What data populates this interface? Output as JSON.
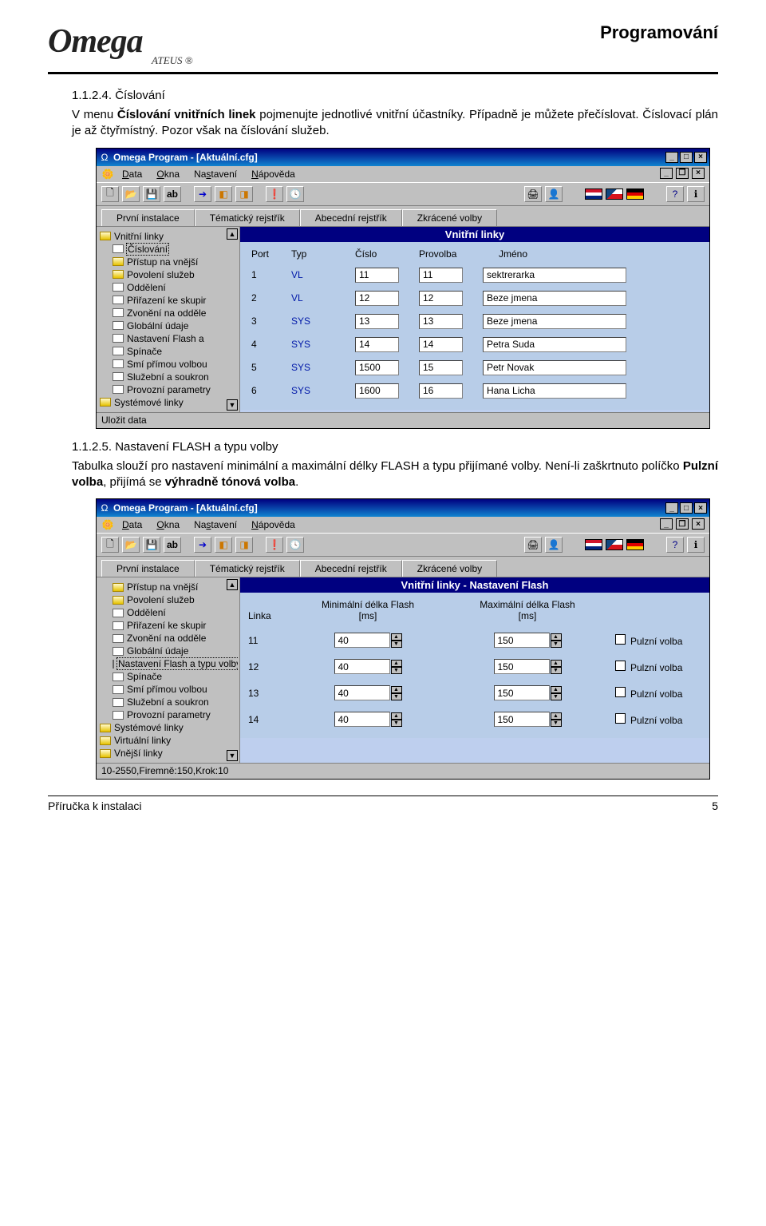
{
  "header": {
    "logo_main": "Omega",
    "logo_sub": "ATEUS ®",
    "page_title": "Programování"
  },
  "sec1": {
    "num": "1.1.2.4. Číslování",
    "para": "V menu Číslování vnitřních linek pojmenujte jednotlivé vnitřní účastníky. Případně je můžete přečíslovat. Číslovací plán je až čtyřmístný. Pozor však na číslování služeb."
  },
  "sec2": {
    "num": "1.1.2.5. Nastavení FLASH a typu volby",
    "para": "Tabulka slouží pro nastavení minimální a maximální délky FLASH a typu přijímané volby. Není-li zaškrtnuto políčko Pulzní volba, přijímá se výhradně tónová volba."
  },
  "app": {
    "title": "Omega Program - [Aktuální.cfg]",
    "menus": [
      "Data",
      "Okna",
      "Nastavení",
      "Nápověda"
    ],
    "tabs": [
      "První instalace",
      "Tématický rejstřík",
      "Abecední rejstřík",
      "Zkrácené volby"
    ],
    "status1": "Uložit data",
    "status2": "10-2550,Firemně:150,Krok:10"
  },
  "tree1": {
    "root": "Vnitřní linky",
    "sel": "Číslování",
    "items": [
      "Přístup na vnější",
      "Povolení služeb",
      "Oddělení",
      "Přiřazení ke skupir",
      "Zvonění na odděle",
      "Globální údaje",
      "Nastavení Flash a",
      "Spínače",
      "Smí přímou volbou",
      "Služební a soukron",
      "Provozní parametry"
    ],
    "last": "Systémové linky"
  },
  "panel1": {
    "title": "Vnitřní linky",
    "cols": {
      "port": "Port",
      "typ": "Typ",
      "cislo": "Číslo",
      "prov": "Provolba",
      "jmeno": "Jméno"
    },
    "rows": [
      {
        "port": "1",
        "typ": "VL",
        "cislo": "11",
        "prov": "11",
        "jmeno": "sektrerarka"
      },
      {
        "port": "2",
        "typ": "VL",
        "cislo": "12",
        "prov": "12",
        "jmeno": "Beze jmena"
      },
      {
        "port": "3",
        "typ": "SYS",
        "cislo": "13",
        "prov": "13",
        "jmeno": "Beze jmena"
      },
      {
        "port": "4",
        "typ": "SYS",
        "cislo": "14",
        "prov": "14",
        "jmeno": "Petra Suda"
      },
      {
        "port": "5",
        "typ": "SYS",
        "cislo": "1500",
        "prov": "15",
        "jmeno": "Petr Novak"
      },
      {
        "port": "6",
        "typ": "SYS",
        "cislo": "1600",
        "prov": "16",
        "jmeno": "Hana Licha"
      }
    ]
  },
  "tree2": {
    "items_top": [
      "Přístup na vnější",
      "Povolení služeb",
      "Oddělení",
      "Přiřazení ke skupir",
      "Zvonění na odděle",
      "Globální údaje"
    ],
    "sel": "Nastavení Flash a typu volby",
    "items_mid": [
      "Spínače",
      "Smí přímou volbou",
      "Služební a soukron",
      "Provozní parametry"
    ],
    "folders": [
      "Systémové linky",
      "Virtuální linky",
      "Vnější linky"
    ]
  },
  "panel2": {
    "title": "Vnitřní linky - Nastavení Flash",
    "hdr": {
      "linka": "Linka",
      "min_l1": "Minimální délka Flash",
      "min_l2": "[ms]",
      "max_l1": "Maximální délka Flash",
      "max_l2": "[ms]",
      "pulz": "Pulzní volba"
    },
    "rows": [
      {
        "linka": "11",
        "min": "40",
        "max": "150"
      },
      {
        "linka": "12",
        "min": "40",
        "max": "150"
      },
      {
        "linka": "13",
        "min": "40",
        "max": "150"
      },
      {
        "linka": "14",
        "min": "40",
        "max": "150"
      }
    ]
  },
  "footer": {
    "left": "Příručka k instalaci",
    "right": "5"
  }
}
